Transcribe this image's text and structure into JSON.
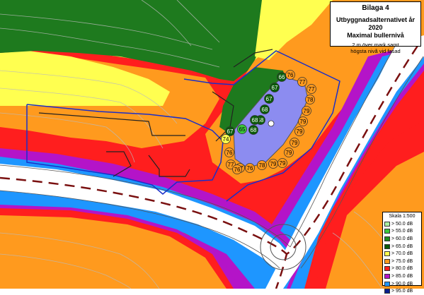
{
  "title": {
    "heading": "Bilaga 4",
    "line1": "Utbyggnadsalternativet år 2020",
    "line2": "Maximal bullernivå",
    "note1": "2 m över mark samt",
    "note2": "högsta nivå vid fasad"
  },
  "legend": {
    "scale": "Skala 1:500",
    "items": [
      {
        "label": ">  50.0 dB",
        "color": "#a8f0a0"
      },
      {
        "label": ">  55.0 dB",
        "color": "#3cc83c"
      },
      {
        "label": ">  60.0 dB",
        "color": "#1e8c1e"
      },
      {
        "label": ">  65.0 dB",
        "color": "#0a5a0a"
      },
      {
        "label": ">  70.0 dB",
        "color": "#ffff50"
      },
      {
        "label": ">  75.0 dB",
        "color": "#ff9a1e"
      },
      {
        "label": ">  80.0 dB",
        "color": "#ff1e1e"
      },
      {
        "label": ">  85.0 dB",
        "color": "#b414c8"
      },
      {
        "label": ">  90.0 dB",
        "color": "#1e96ff"
      },
      {
        "label": ">  95.0 dB",
        "color": "#0a1e8c"
      }
    ]
  },
  "markers": [
    {
      "value": "66",
      "color": "#0a5a0a"
    },
    {
      "value": "76",
      "color": "#ff9a1e"
    },
    {
      "value": "77",
      "color": "#ff9a1e"
    },
    {
      "value": "67",
      "color": "#0a5a0a"
    },
    {
      "value": "77",
      "color": "#ff9a1e"
    },
    {
      "value": "67",
      "color": "#0a5a0a"
    },
    {
      "value": "78",
      "color": "#ff9a1e"
    },
    {
      "value": "68",
      "color": "#0a5a0a"
    },
    {
      "value": "79",
      "color": "#ff9a1e"
    },
    {
      "value": "68",
      "color": "#0a5a0a"
    },
    {
      "value": "79",
      "color": "#ff9a1e"
    },
    {
      "value": "68",
      "color": "#0a5a0a"
    },
    {
      "value": "79",
      "color": "#ff9a1e"
    },
    {
      "value": "65",
      "color": "#3cc83c"
    },
    {
      "value": "68",
      "color": "#0a5a0a"
    },
    {
      "value": "79",
      "color": "#ff9a1e"
    },
    {
      "value": "67",
      "color": "#0a5a0a"
    },
    {
      "value": "74",
      "color": "#ffff50"
    },
    {
      "value": "79",
      "color": "#ff9a1e"
    },
    {
      "value": "76",
      "color": "#ff9a1e"
    },
    {
      "value": "79",
      "color": "#ff9a1e"
    },
    {
      "value": "77",
      "color": "#ff9a1e"
    },
    {
      "value": "79",
      "color": "#ff9a1e"
    },
    {
      "value": "77",
      "color": "#ff9a1e"
    },
    {
      "value": "76",
      "color": "#ff9a1e"
    },
    {
      "value": "76",
      "color": "#ff9a1e"
    },
    {
      "value": "78",
      "color": "#ff9a1e"
    }
  ]
}
